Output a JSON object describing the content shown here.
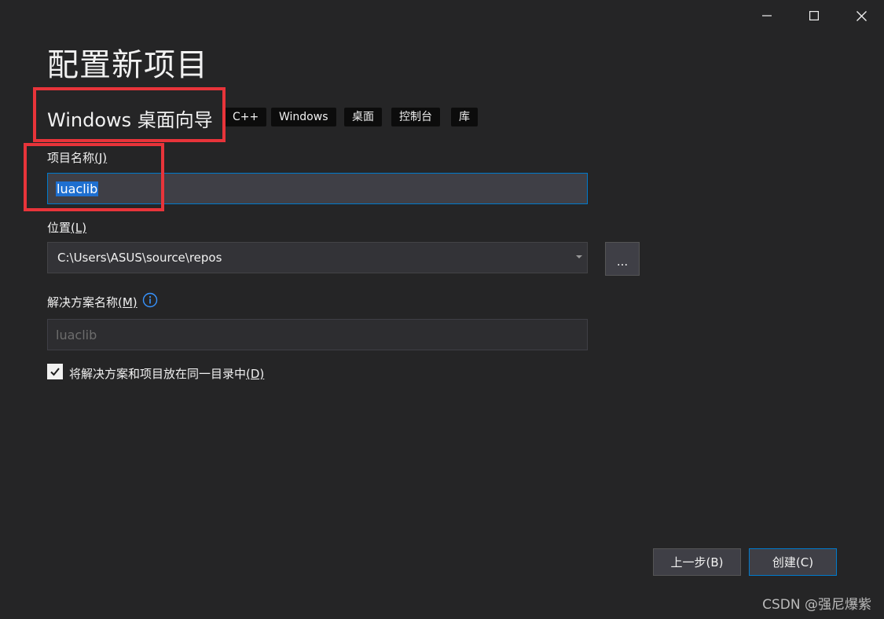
{
  "window": {
    "controls": {
      "minimize": "minimize-icon",
      "maximize": "maximize-icon",
      "close": "close-icon"
    }
  },
  "header": {
    "title": "配置新项目",
    "template_name": "Windows 桌面向导",
    "tags": [
      "C++",
      "Windows",
      "桌面",
      "控制台",
      "库"
    ]
  },
  "form": {
    "project_name": {
      "label": "项目名称",
      "mnemonic": "(J)",
      "value": "luaclib"
    },
    "location": {
      "label": "位置",
      "mnemonic": "(L)",
      "value": "C:\\Users\\ASUS\\source\\repos",
      "browse_label": "..."
    },
    "solution_name": {
      "label": "解决方案名称",
      "mnemonic": "(M)",
      "value": "luaclib",
      "info_icon": "info-icon"
    },
    "same_dir": {
      "checked": true,
      "label": "将解决方案和项目放在同一目录中",
      "mnemonic": "(D)"
    }
  },
  "footer": {
    "back_label": "上一步(B)",
    "create_label": "创建(C)"
  },
  "watermark": "CSDN @强尼爆紫",
  "colors": {
    "background": "#252526",
    "accent": "#007acc",
    "highlight_annotation": "#e8343a"
  }
}
